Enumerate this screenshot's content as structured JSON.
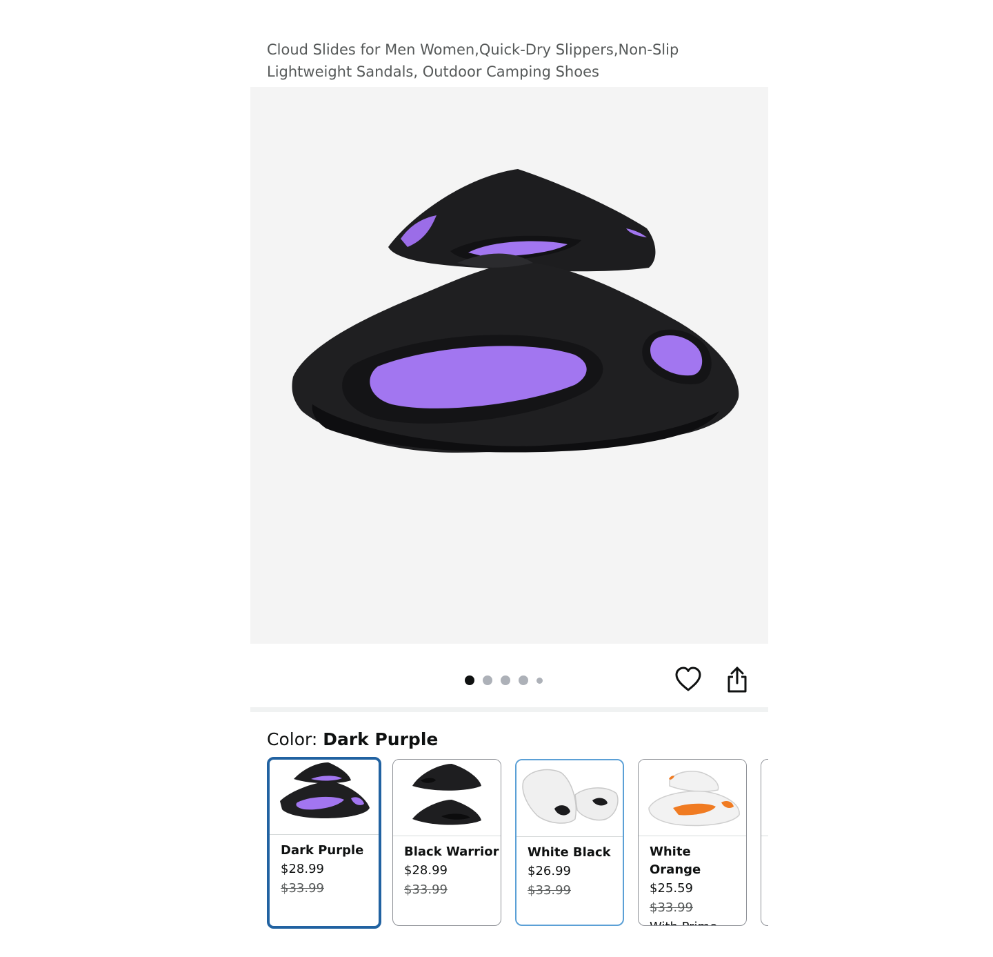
{
  "product": {
    "title": "Cloud Slides for Men Women,Quick-Dry Slippers,Non-Slip Lightweight Sandals, Outdoor Camping Shoes"
  },
  "gallery": {
    "dot_count": 5,
    "active_index": 0
  },
  "actions": {
    "favorite_icon": "heart-icon",
    "share_icon": "share-icon"
  },
  "color_selector": {
    "label": "Color: ",
    "selected_value": "Dark Purple",
    "options": [
      {
        "name": "Dark Purple",
        "price": "$28.99",
        "list_price": "$33.99",
        "note": "",
        "accent": "#a276f0",
        "base": "#1b1b1d"
      },
      {
        "name": "Black Warrior",
        "price": "$28.99",
        "list_price": "$33.99",
        "note": "",
        "accent": "#2a2a2a",
        "base": "#1b1b1d"
      },
      {
        "name": "White Black",
        "price": "$26.99",
        "list_price": "$33.99",
        "note": "",
        "accent": "#1b1b1d",
        "base": "#f2f2f2"
      },
      {
        "name": "White Orange",
        "price": "$25.59",
        "list_price": "$33.99",
        "note": "With Prime",
        "accent": "#f07b22",
        "base": "#f2f2f2"
      }
    ]
  },
  "colors": {
    "selected_border": "#2162a1",
    "available_border": "#5ba0d6",
    "product_accent": "#a276f0"
  }
}
